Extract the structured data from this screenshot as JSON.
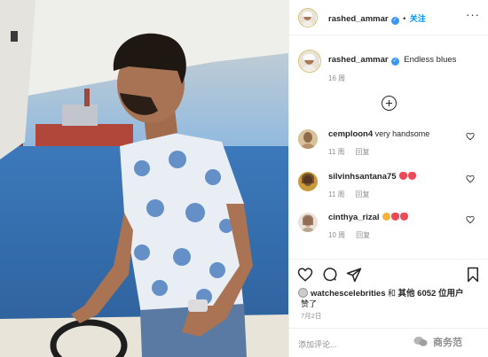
{
  "post": {
    "author": "rashed_ammar",
    "follow_label": "关注",
    "caption": "Endless blues",
    "caption_time": "16 周",
    "likes_user": "watchescelebrities",
    "likes_connector": "和",
    "likes_others": "其他 6052 位用户",
    "likes_suffix": "赞了",
    "date": "7月2日",
    "comment_placeholder": "添加评论...",
    "watermark": "商务范"
  },
  "comments": [
    {
      "user": "cemploon4",
      "text": "very handsome",
      "time": "11 周",
      "reply": "回复",
      "emojis": []
    },
    {
      "user": "silvinhsantana75",
      "text": "",
      "time": "11 周",
      "reply": "回复",
      "emojis": [
        "red-heart",
        "red-heart"
      ]
    },
    {
      "user": "cinthya_rizal",
      "text": "",
      "time": "10 周",
      "reply": "回复",
      "emojis": [
        "heart-eyes-face",
        "red-heart",
        "red-heart"
      ]
    }
  ],
  "colors": {
    "verified": "#3897f0",
    "follow": "#0095f6",
    "muted": "#8e8e8e",
    "heart": "#ed4956"
  },
  "icons": [
    "more-options-icon",
    "translate-icon",
    "like-heart-icon",
    "comment-icon",
    "share-icon",
    "bookmark-icon"
  ]
}
